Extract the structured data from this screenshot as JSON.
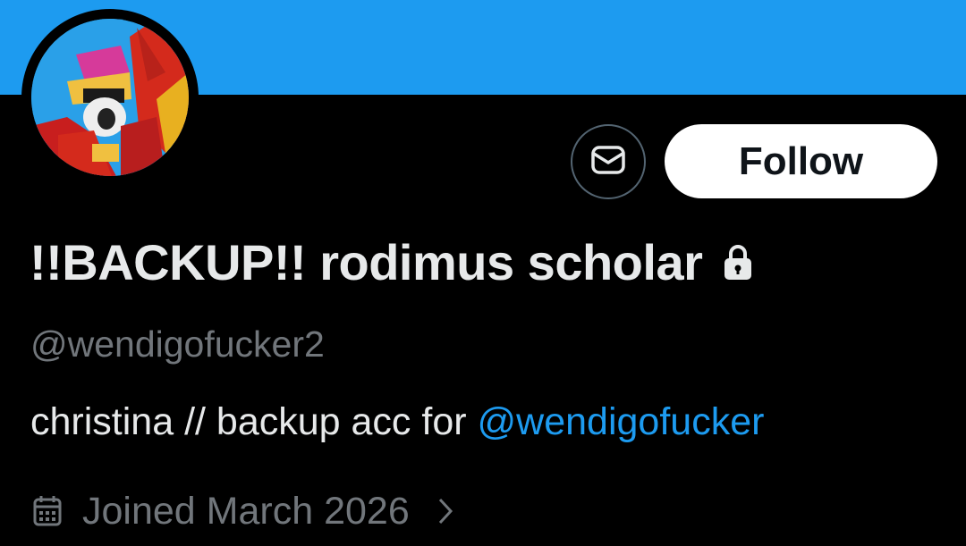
{
  "profile": {
    "display_name": "!!BACKUP!! rodimus scholar",
    "handle": "@wendigofucker2",
    "bio_text": "christina // backup acc for ",
    "bio_mention": "@wendigofucker",
    "joined": "Joined March 2026"
  },
  "actions": {
    "follow_label": "Follow"
  },
  "icons": {
    "message": "envelope-icon",
    "protected": "lock-icon",
    "joined": "calendar-icon",
    "expand": "chevron-right-icon"
  },
  "colors": {
    "banner": "#1d9bf0",
    "background": "#000000",
    "primary_text": "#e7e9ea",
    "secondary_text": "#71767b",
    "link": "#1d9bf0",
    "follow_bg": "#ffffff"
  }
}
